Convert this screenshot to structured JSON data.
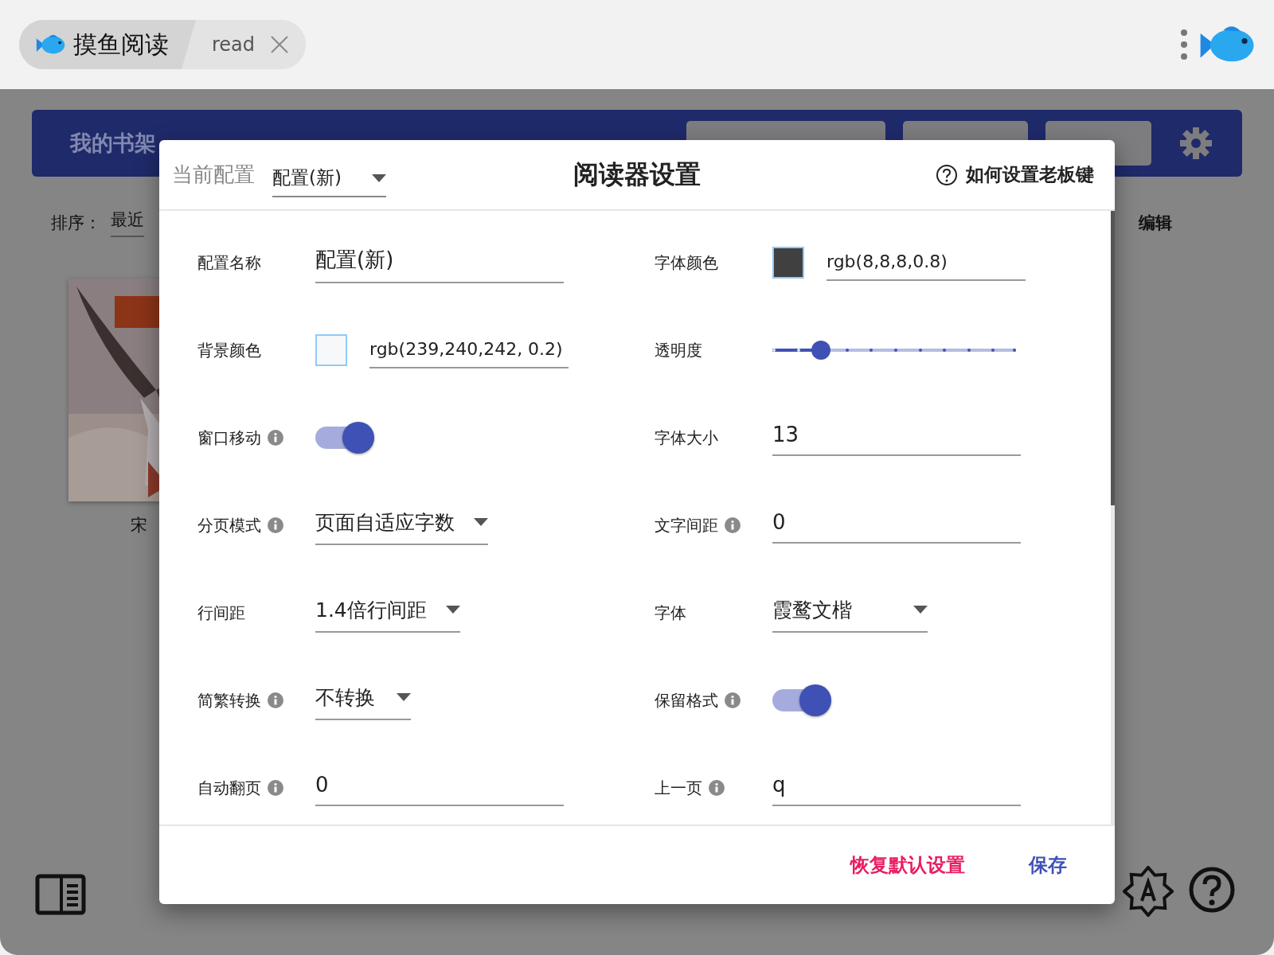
{
  "app_tabs": [
    {
      "label": "摸鱼阅读",
      "selected": true
    },
    {
      "label": "read",
      "selected": false
    }
  ],
  "background": {
    "header_title": "我的书架",
    "sort_label": "排序：",
    "sort_value": "最近",
    "edit": "编辑",
    "books": [
      {
        "title": "宋"
      }
    ]
  },
  "dialog": {
    "config_label": "当前配置",
    "config_value": "配置(新)",
    "title": "阅读器设置",
    "help_link": "如何设置老板键",
    "fields": [
      {
        "kind": "text",
        "label": "配置名称",
        "info": false,
        "value": "配置(新)"
      },
      {
        "kind": "color",
        "label": "字体颜色",
        "info": false,
        "value": "rgb(8,8,8,0.8)",
        "color": "#404040"
      },
      {
        "kind": "color",
        "label": "背景颜色",
        "info": false,
        "value": "rgb(239,240,242, 0.2)",
        "color": "#f7f8fa"
      },
      {
        "kind": "slider",
        "label": "透明度",
        "info": false,
        "level": 0.2
      },
      {
        "kind": "switch",
        "label": "窗口移动",
        "info": true,
        "on": true
      },
      {
        "kind": "text",
        "label": "字体大小",
        "info": false,
        "value": "13"
      },
      {
        "kind": "select",
        "label": "分页模式",
        "info": true,
        "value": "页面自适应字数"
      },
      {
        "kind": "text",
        "label": "文字间距",
        "info": true,
        "value": "0"
      },
      {
        "kind": "select",
        "label": "行间距",
        "info": false,
        "value": "1.4倍行间距"
      },
      {
        "kind": "select",
        "label": "字体",
        "info": false,
        "value": "霞鹜文楷"
      },
      {
        "kind": "select",
        "label": "简繁转换",
        "info": true,
        "value": "不转换"
      },
      {
        "kind": "switch",
        "label": "保留格式",
        "info": true,
        "on": true
      },
      {
        "kind": "text",
        "label": "自动翻页",
        "info": true,
        "value": "0"
      },
      {
        "kind": "text",
        "label": "上一页",
        "info": true,
        "value": "q"
      }
    ],
    "buttons": [
      {
        "label": "恢复默认设置",
        "kind": "reset"
      },
      {
        "label": "保存",
        "kind": "save"
      }
    ]
  }
}
